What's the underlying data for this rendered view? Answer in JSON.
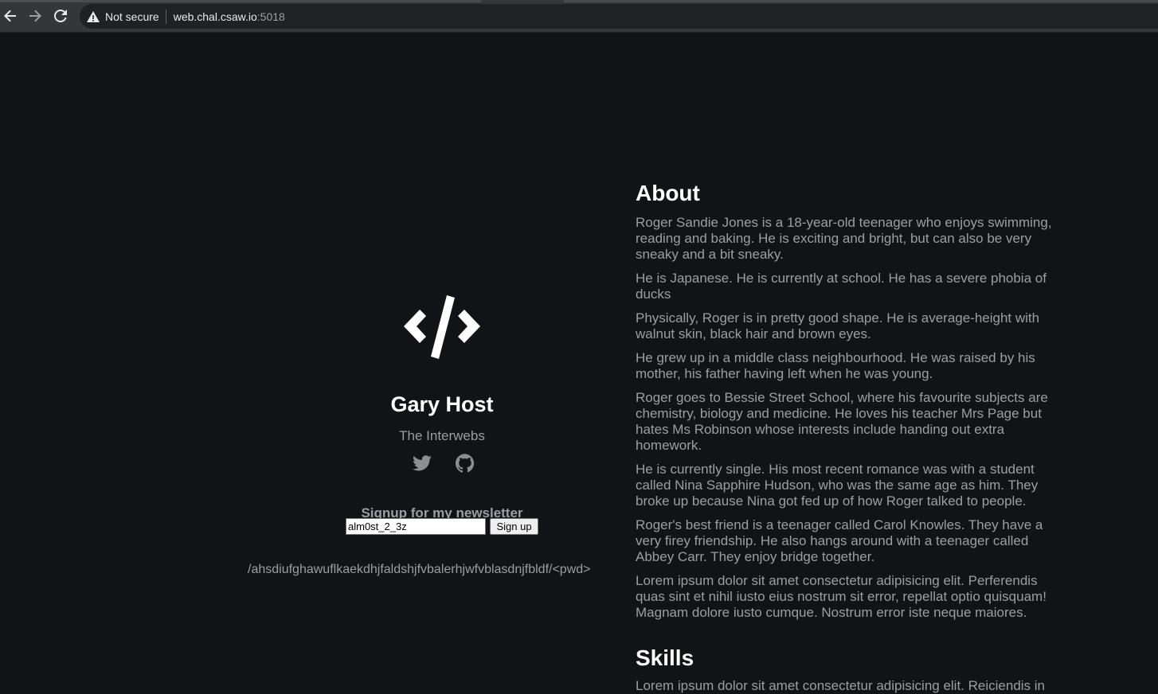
{
  "browser": {
    "security_label": "Not secure",
    "url_host": "web.chal.csaw.io",
    "url_port": ":5018"
  },
  "profile": {
    "logo_icon": "code-brackets-icon",
    "name": "Gary Host",
    "location": "The Interwebs",
    "social_icons": [
      "twitter-icon",
      "github-icon"
    ],
    "newsletter_title": "Signup for my newsletter",
    "newsletter_input_value": "alm0st_2_3z",
    "signup_button": "Sign up",
    "hidden_path": "/ahsdiufghawuflkaekdhjfaldshjfvbalerhjwfvblasdnjfbldf/<pwd>"
  },
  "about": {
    "title": "About",
    "paragraphs": [
      "Roger Sandie Jones is a 18-year-old teenager who enjoys swimming, reading and baking. He is exciting and bright, but can also be very sneaky and a bit sneaky.",
      "He is Japanese. He is currently at school. He has a severe phobia of ducks",
      "Physically, Roger is in pretty good shape. He is average-height with walnut skin, black hair and brown eyes.",
      "He grew up in a middle class neighbourhood. He was raised by his mother, his father having left when he was young.",
      "Roger goes to Bessie Street School, where his favourite subjects are chemistry, biology and medicine. He loves his teacher Mrs Page but hates Ms Robinson whose interests include handing out extra homework.",
      "He is currently single. His most recent romance was with a student called Nina Sapphire Hudson, who was the same age as him. They broke up because Nina got fed up of how Roger talked to people.",
      "Roger's best friend is a teenager called Carol Knowles. They have a very firey friendship. He also hangs around with a teenager called Abbey Carr. They enjoy bridge together.",
      "Lorem ipsum dolor sit amet consectetur adipisicing elit. Perferendis quas sint et nihil iusto eius nostrum sit error, repellat optio quisquam! Magnam dolore iusto cumque. Nostrum error iste neque maiores."
    ]
  },
  "skills": {
    "title": "Skills",
    "text": "Lorem ipsum dolor sit amet consectetur adipisicing elit. Reiciendis in"
  }
}
